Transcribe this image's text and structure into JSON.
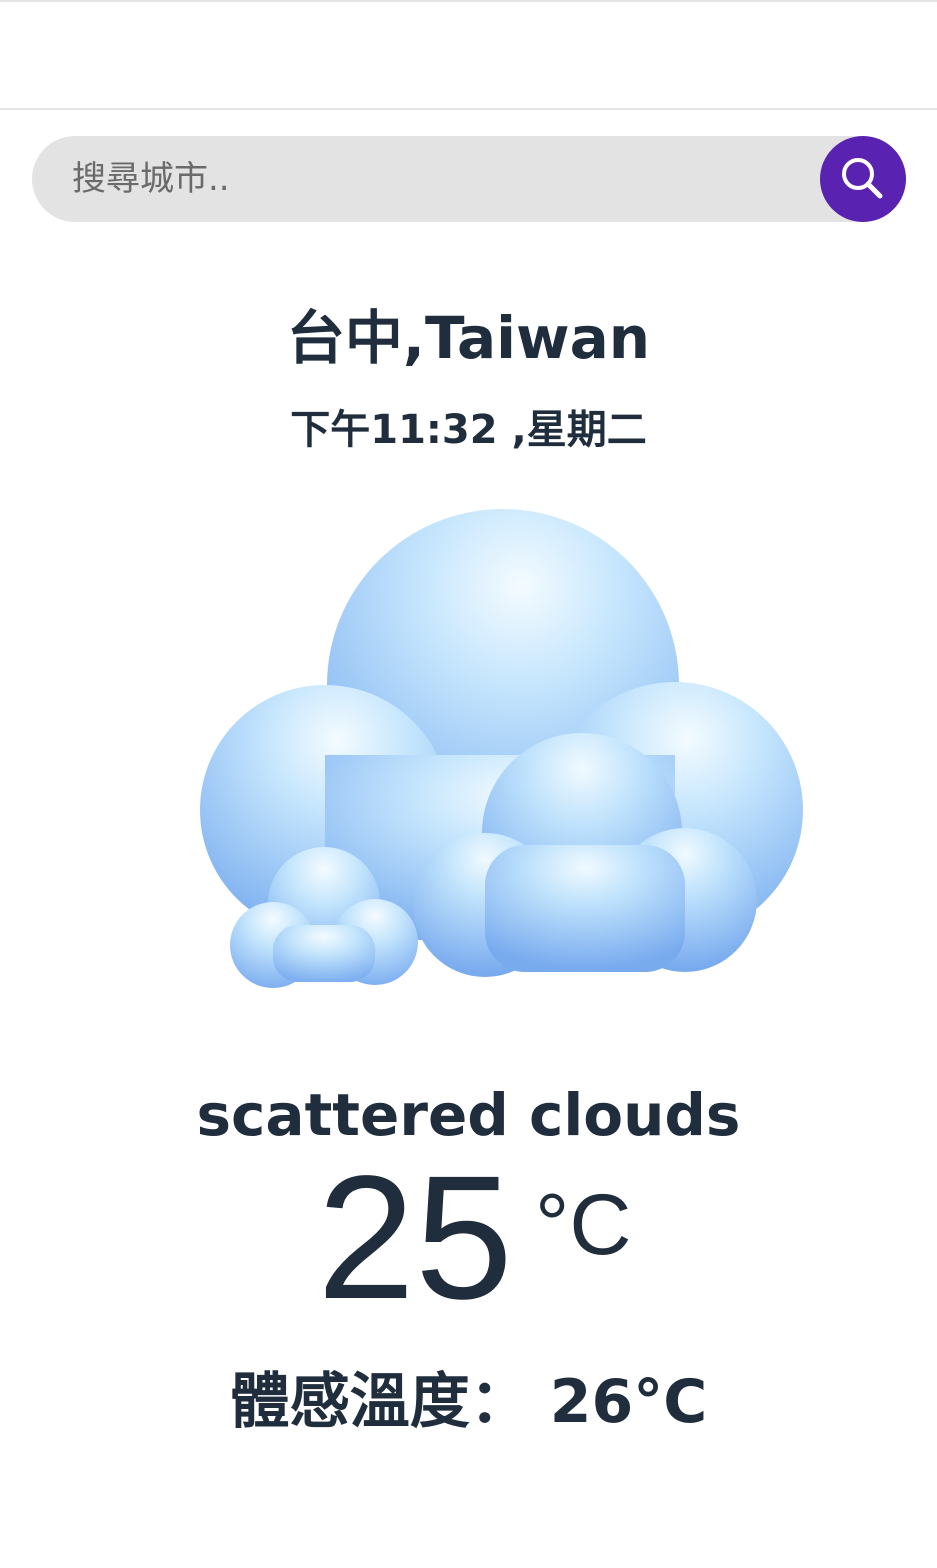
{
  "search": {
    "placeholder": "搜尋城市..",
    "button_icon": "search-icon"
  },
  "location": {
    "city_line": "台中,Taiwan",
    "datetime": "下午11:32 ,星期二"
  },
  "weather": {
    "icon": "cloud-icon",
    "description": "scattered clouds",
    "temperature": "25",
    "unit": "°C",
    "feels_like_label": "體感溫度：",
    "feels_like_value": "26°C"
  },
  "colors": {
    "accent": "#5a22b0",
    "text": "#1f2d3d",
    "search_bg": "#e3e3e3",
    "cloud_light": "#dff2ff",
    "cloud_dark": "#7aaef0"
  }
}
